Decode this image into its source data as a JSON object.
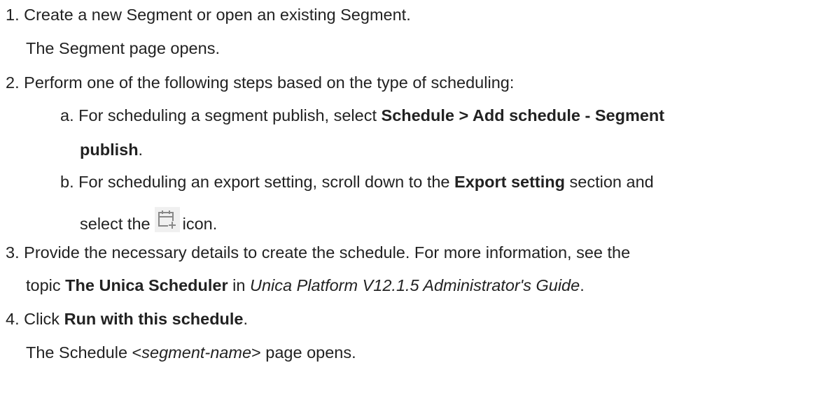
{
  "steps": [
    {
      "number": "1.",
      "text": "Create a new Segment or open an existing Segment.",
      "result": "The Segment page opens."
    },
    {
      "number": "2.",
      "text": "Perform one of the following steps based on the type of scheduling:",
      "substeps": [
        {
          "letter": "a.",
          "pre": "For scheduling a segment publish, select ",
          "bold": "Schedule > Add schedule - Segment",
          "bold2": "publish",
          "post": "."
        },
        {
          "letter": "b.",
          "pre": "For scheduling an export setting, scroll down to the ",
          "bold": "Export setting",
          "post": " section and",
          "line2_pre": "select the",
          "icon": "calendar-add-icon",
          "line2_post": "icon."
        }
      ]
    },
    {
      "number": "3.",
      "text": "Provide the necessary details to create the schedule. For more information, see the",
      "line2_pre": "topic ",
      "bold": "The Unica Scheduler",
      "line2_mid": " in ",
      "italic": "Unica Platform V12.1.5 Administrator's Guide",
      "line2_post": "."
    },
    {
      "number": "4.",
      "pre": "Click ",
      "bold": "Run with this schedule",
      "post": ".",
      "result_pre": "The Schedule <",
      "result_italic": "segment-name",
      "result_post": "> page opens."
    }
  ]
}
